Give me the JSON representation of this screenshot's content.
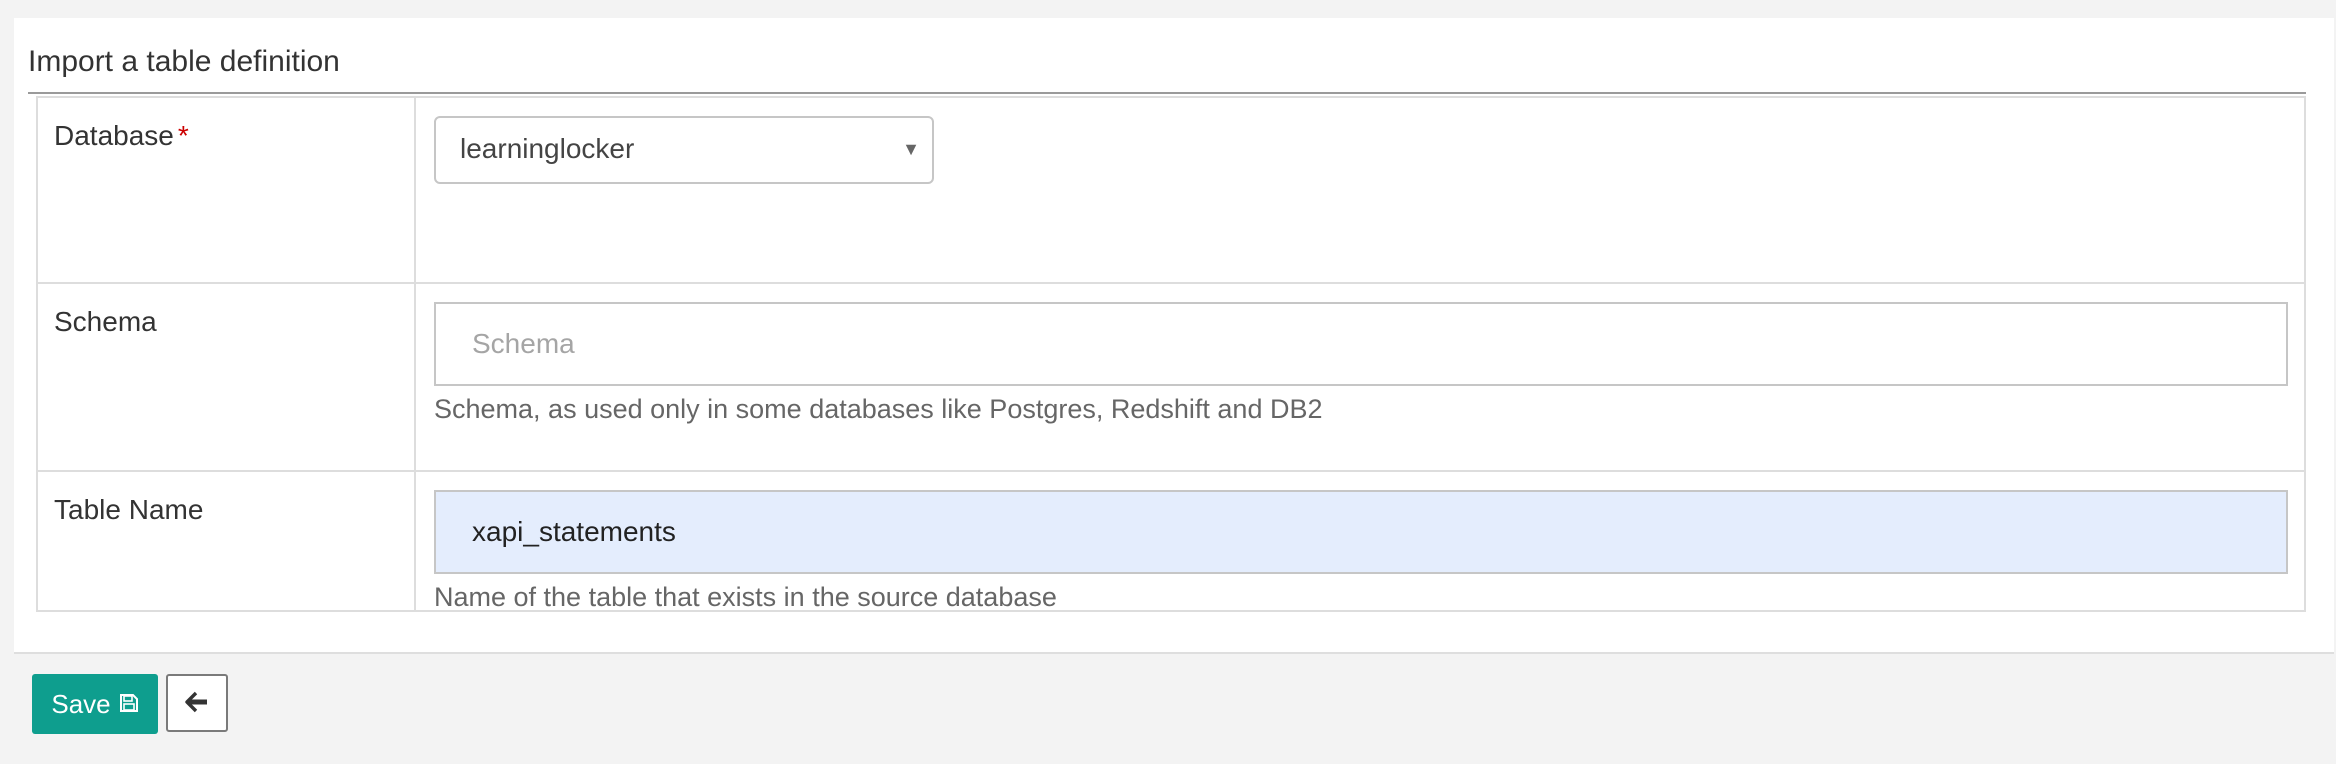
{
  "form": {
    "title": "Import a table definition",
    "fields": {
      "database": {
        "label": "Database",
        "required_marker": "*",
        "selected": "learninglocker"
      },
      "schema": {
        "label": "Schema",
        "value": "",
        "placeholder": "Schema",
        "help": "Schema, as used only in some databases like Postgres, Redshift and DB2"
      },
      "table_name": {
        "label": "Table Name",
        "value": "xapi_statements",
        "placeholder": "",
        "help": "Name of the table that exists in the source database"
      }
    }
  },
  "footer": {
    "save_label": "Save",
    "save_icon": "floppy-disk-icon",
    "back_icon": "arrow-left-icon"
  },
  "colors": {
    "primary": "#0e9e8e",
    "required": "#cc0000",
    "autofill": "#e4edfd"
  }
}
